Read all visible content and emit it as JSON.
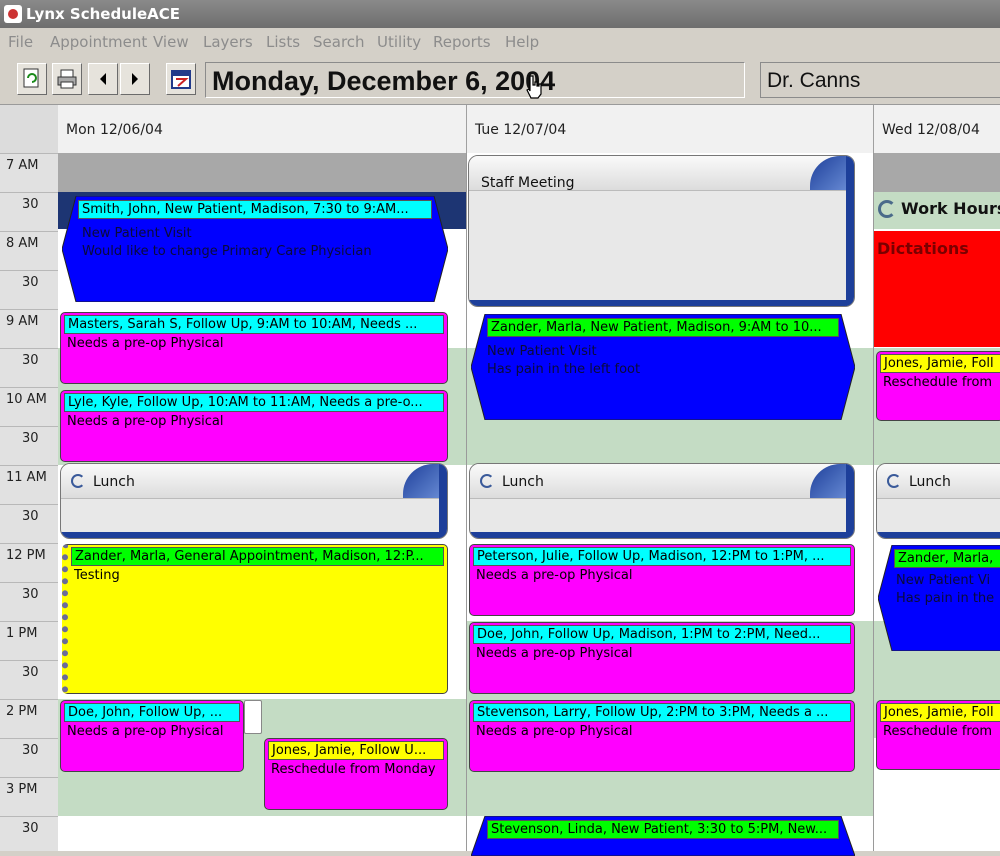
{
  "window": {
    "title": "Lynx ScheduleACE"
  },
  "menu": [
    "File",
    "Appointment",
    "View",
    "Layers",
    "Lists",
    "Search",
    "Utility",
    "Reports",
    "Help"
  ],
  "toolbar": {
    "date_display": "Monday, December 6, 2004",
    "provider": "Dr. Canns",
    "buttons": [
      "refresh-icon",
      "print-icon",
      "prev-arrow-icon",
      "next-arrow-icon",
      "calendar-icon"
    ]
  },
  "days": [
    "Mon 12/06/04",
    "Tue 12/07/04",
    "Wed 12/08/04"
  ],
  "times": [
    "7 AM",
    "30",
    "8 AM",
    "30",
    "9 AM",
    "30",
    "10 AM",
    "30",
    "11 AM",
    "30",
    "12 PM",
    "30",
    "1 PM",
    "30",
    "2 PM",
    "30",
    "3 PM",
    "30"
  ],
  "colors": {
    "pink": "#ff00ff",
    "cyan": "#00ffff",
    "green": "#00ff00",
    "yellow": "#ffff00",
    "blue": "#0000ff",
    "red": "#ff0000",
    "band": "#c4dcc4",
    "navy": "#1d3f9a"
  },
  "mon": {
    "smith": {
      "header": "Smith, John, New Patient, Madison, 7:30 to 9:AM...",
      "line1": "New Patient Visit",
      "line2": "Would like to change Primary Care Physician"
    },
    "masters": {
      "header": "Masters, Sarah S, Follow Up, 9:AM to 10:AM, Needs ...",
      "line1": "Needs a pre-op Physical"
    },
    "lyle": {
      "header": "Lyle, Kyle, Follow Up, 10:AM to 11:AM, Needs a pre-o...",
      "line1": "Needs a pre-op Physical"
    },
    "lunch": "Lunch",
    "zander": {
      "header": "Zander, Marla, General Appointment, Madison, 12:P...",
      "line1": "Testing"
    },
    "doe": {
      "header": "Doe, John, Follow Up, ...",
      "line1": "Needs a pre-op Physical"
    },
    "jones": {
      "header": "Jones, Jamie, Follow U...",
      "line1": "Reschedule from Monday"
    }
  },
  "tue": {
    "staff": "Staff Meeting",
    "zander": {
      "header": "Zander, Marla, New Patient, Madison, 9:AM to 10...",
      "line1": "New Patient Visit",
      "line2": "Has pain in the left foot"
    },
    "lunch": "Lunch",
    "peterson": {
      "header": "Peterson, Julie, Follow Up, Madison, 12:PM to 1:PM, ...",
      "line1": "Needs a pre-op Physical"
    },
    "doe": {
      "header": "Doe, John, Follow Up, Madison, 1:PM to 2:PM, Need...",
      "line1": "Needs a pre-op Physical"
    },
    "stevenson_larry": {
      "header": "Stevenson, Larry, Follow Up, 2:PM to 3:PM, Needs a ...",
      "line1": "Needs a pre-op Physical"
    },
    "stevenson_linda": {
      "header": "Stevenson, Linda, New Patient, 3:30 to 5:PM, New..."
    }
  },
  "wed": {
    "workhours": "Work Hours",
    "dictations": "Dictations",
    "jones1": {
      "header": "Jones, Jamie, Foll",
      "line1": "Reschedule from"
    },
    "lunch": "Lunch",
    "zander": {
      "header": "Zander, Marla,",
      "line1": "New Patient Vi",
      "line2": "Has pain in the"
    },
    "jones2": {
      "header": "Jones, Jamie, Foll",
      "line1": "Reschedule from"
    }
  }
}
